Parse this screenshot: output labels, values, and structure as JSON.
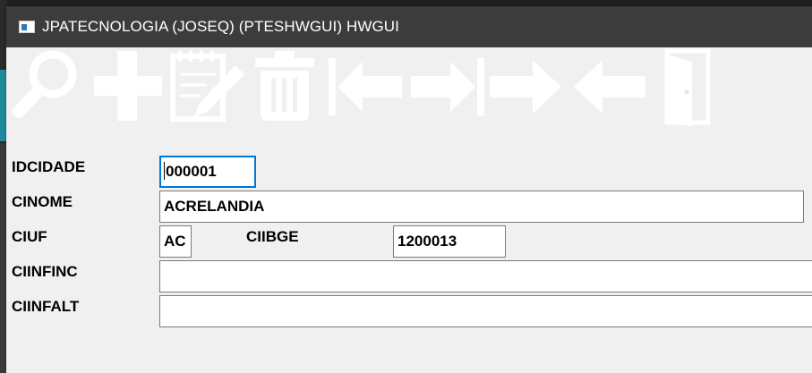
{
  "window": {
    "title": "JPATECNOLOGIA (JOSEQ) (PTESHWGUI) HWGUI"
  },
  "toolbar": [
    {
      "name": "search",
      "icon": "magnifier-icon"
    },
    {
      "name": "add",
      "icon": "plus-icon"
    },
    {
      "name": "edit",
      "icon": "notepad-pencil-icon"
    },
    {
      "name": "delete",
      "icon": "trash-icon"
    },
    {
      "name": "first",
      "icon": "first-record-icon"
    },
    {
      "name": "last",
      "icon": "last-record-icon"
    },
    {
      "name": "next",
      "icon": "arrow-right-icon"
    },
    {
      "name": "previous",
      "icon": "arrow-left-icon"
    },
    {
      "name": "exit",
      "icon": "door-exit-icon"
    }
  ],
  "form": {
    "idcidade": {
      "label": "IDCIDADE",
      "value": "000001"
    },
    "cinome": {
      "label": "CINOME",
      "value": "ACRELANDIA"
    },
    "ciuf": {
      "label": "CIUF",
      "value": "AC"
    },
    "ciibge": {
      "label": "CIIBGE",
      "value": "1200013"
    },
    "ciinfinc": {
      "label": "CIINFINC",
      "value": ""
    },
    "ciinfalt": {
      "label": "CIINFALT",
      "value": ""
    }
  },
  "colors": {
    "titlebar": "#3c3c3c",
    "window_bg": "#f0f0f0",
    "focus_border": "#0078d7",
    "toolbar_icon": "#ffffff"
  }
}
